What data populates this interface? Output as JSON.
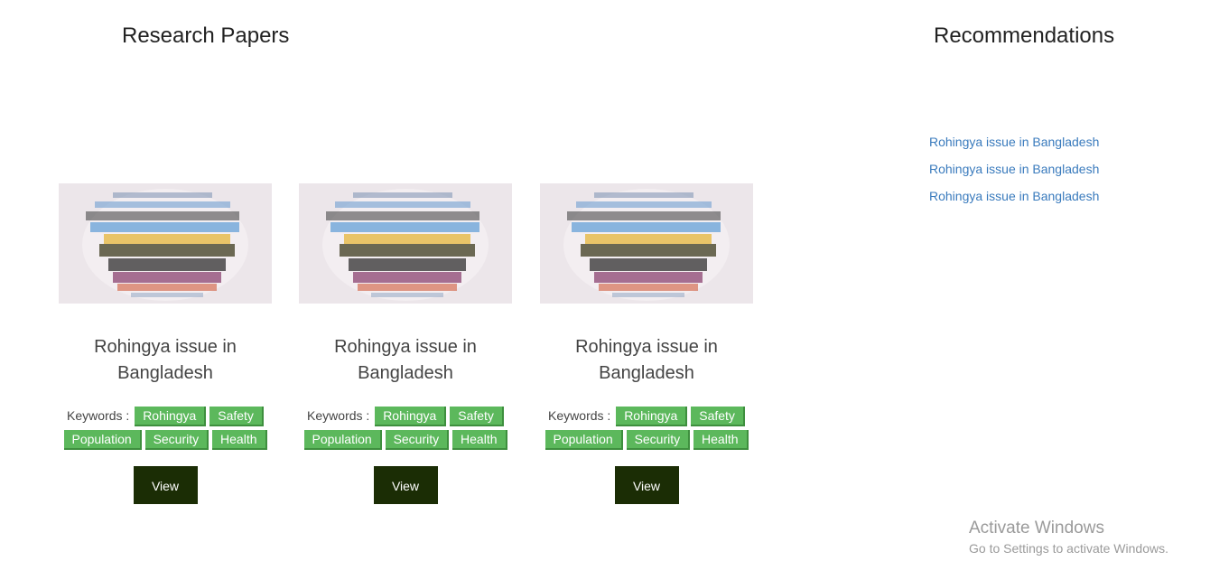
{
  "papers_section": {
    "title": "Research Papers"
  },
  "recommendations_section": {
    "title": "Recommendations",
    "links": [
      "Rohingya issue in Bangladesh",
      "Rohingya issue in Bangladesh",
      "Rohingya issue in Bangladesh"
    ]
  },
  "cards": [
    {
      "title": "Rohingya issue in Bangladesh",
      "keywords_label": "Keywords :",
      "keywords": [
        "Rohingya",
        "Safety",
        "Population",
        "Security",
        "Health"
      ],
      "view_label": "View"
    },
    {
      "title": "Rohingya issue in Bangladesh",
      "keywords_label": "Keywords :",
      "keywords": [
        "Rohingya",
        "Safety",
        "Population",
        "Security",
        "Health"
      ],
      "view_label": "View"
    },
    {
      "title": "Rohingya issue in Bangladesh",
      "keywords_label": "Keywords :",
      "keywords": [
        "Rohingya",
        "Safety",
        "Population",
        "Security",
        "Health"
      ],
      "view_label": "View"
    }
  ],
  "watermark": {
    "line1": "Activate Windows",
    "line2": "Go to Settings to activate Windows."
  },
  "colors": {
    "tag_green": "#5cb85c",
    "view_button": "#1b2d05",
    "link_blue": "#3a7bbd"
  }
}
